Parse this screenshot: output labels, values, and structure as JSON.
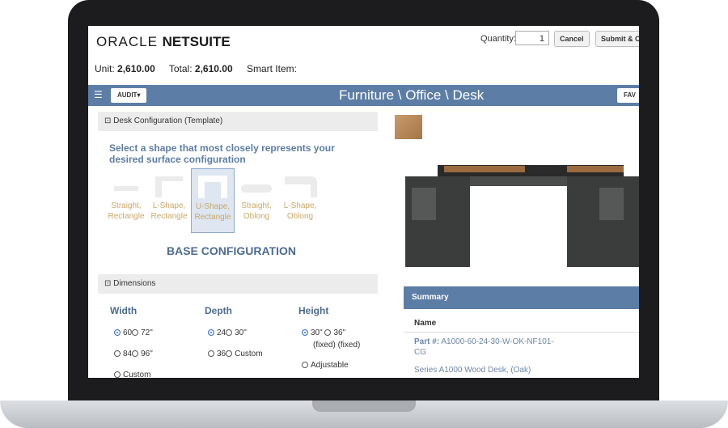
{
  "header": {
    "logo_brand": "ORACLE",
    "logo_product": "NETSUITE",
    "quantity_label": "Quantity:",
    "quantity_value": "1",
    "cancel_label": "Cancel",
    "submit_label": "Submit & C"
  },
  "info": {
    "unit_label": "Unit:",
    "unit_value": "2,610.00",
    "total_label": "Total:",
    "total_value": "2,610.00",
    "smart_item_label": "Smart Item:"
  },
  "banner": {
    "menu_icon": "hamburger-icon",
    "audit_label": "AUDIT▾",
    "title": "Furniture \\ Office \\ Desk",
    "fav_label": "FAV"
  },
  "desk_config": {
    "section_title": "⊡ Desk Configuration (Template)",
    "prompt": "Select a shape that most closely represents your desired surface configuration",
    "shapes": [
      {
        "line1": "Straight,",
        "line2": "Rectangle"
      },
      {
        "line1": "L-Shape,",
        "line2": "Rectangle"
      },
      {
        "line1": "U-Shape,",
        "line2": "Rectangle"
      },
      {
        "line1": "Straight,",
        "line2": "Oblong"
      },
      {
        "line1": "L-Shape,",
        "line2": "Oblong"
      }
    ],
    "selected_shape": "U-Shape, Rectangle",
    "base_config_label": "BASE CONFIGURATION"
  },
  "dimensions": {
    "section_title": "⊡ Dimensions",
    "width": {
      "label": "Width",
      "options": [
        "60",
        "72\"",
        "84",
        "96\"",
        "Custom"
      ],
      "selected": "60"
    },
    "depth": {
      "label": "Depth",
      "options": [
        "24",
        "30\"",
        "36",
        "Custom"
      ],
      "selected": "24"
    },
    "height": {
      "label": "Height",
      "options": [
        "30\"",
        "36\"",
        "(fixed)",
        "(fixed)",
        "Adjustable"
      ],
      "selected": "30\""
    }
  },
  "summary": {
    "title": "Summary",
    "name_label": "Name",
    "part_label": "Part #:",
    "part_value": "A1000-60-24-30-W-OK-NF101-CG",
    "description": "Series A1000 Wood Desk, (Oak)"
  },
  "colors": {
    "banner": "#5c7da6",
    "accent_text": "#4d6b8f",
    "shape_label": "#c9a866"
  }
}
